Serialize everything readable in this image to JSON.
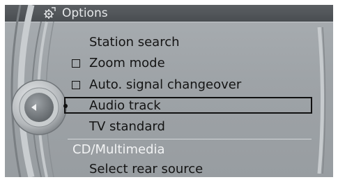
{
  "header": {
    "title": "Options",
    "icon": "options-gear-icon"
  },
  "menu": {
    "items": [
      {
        "label": "Station search",
        "checkbox": false
      },
      {
        "label": "Zoom mode",
        "checkbox": true,
        "checked": false
      },
      {
        "label": "Auto. signal changeover",
        "checkbox": true,
        "checked": false
      },
      {
        "label": "Audio track",
        "checkbox": false,
        "selected": true
      },
      {
        "label": "TV standard",
        "checkbox": false
      }
    ],
    "section_header": "CD/Multimedia",
    "section_items": [
      {
        "label": "Select rear source"
      }
    ]
  },
  "colors": {
    "background": "#9ea3a7",
    "title_bar": "#4e5256",
    "text": "#141414",
    "section_header_text": "#f2f3f4"
  }
}
